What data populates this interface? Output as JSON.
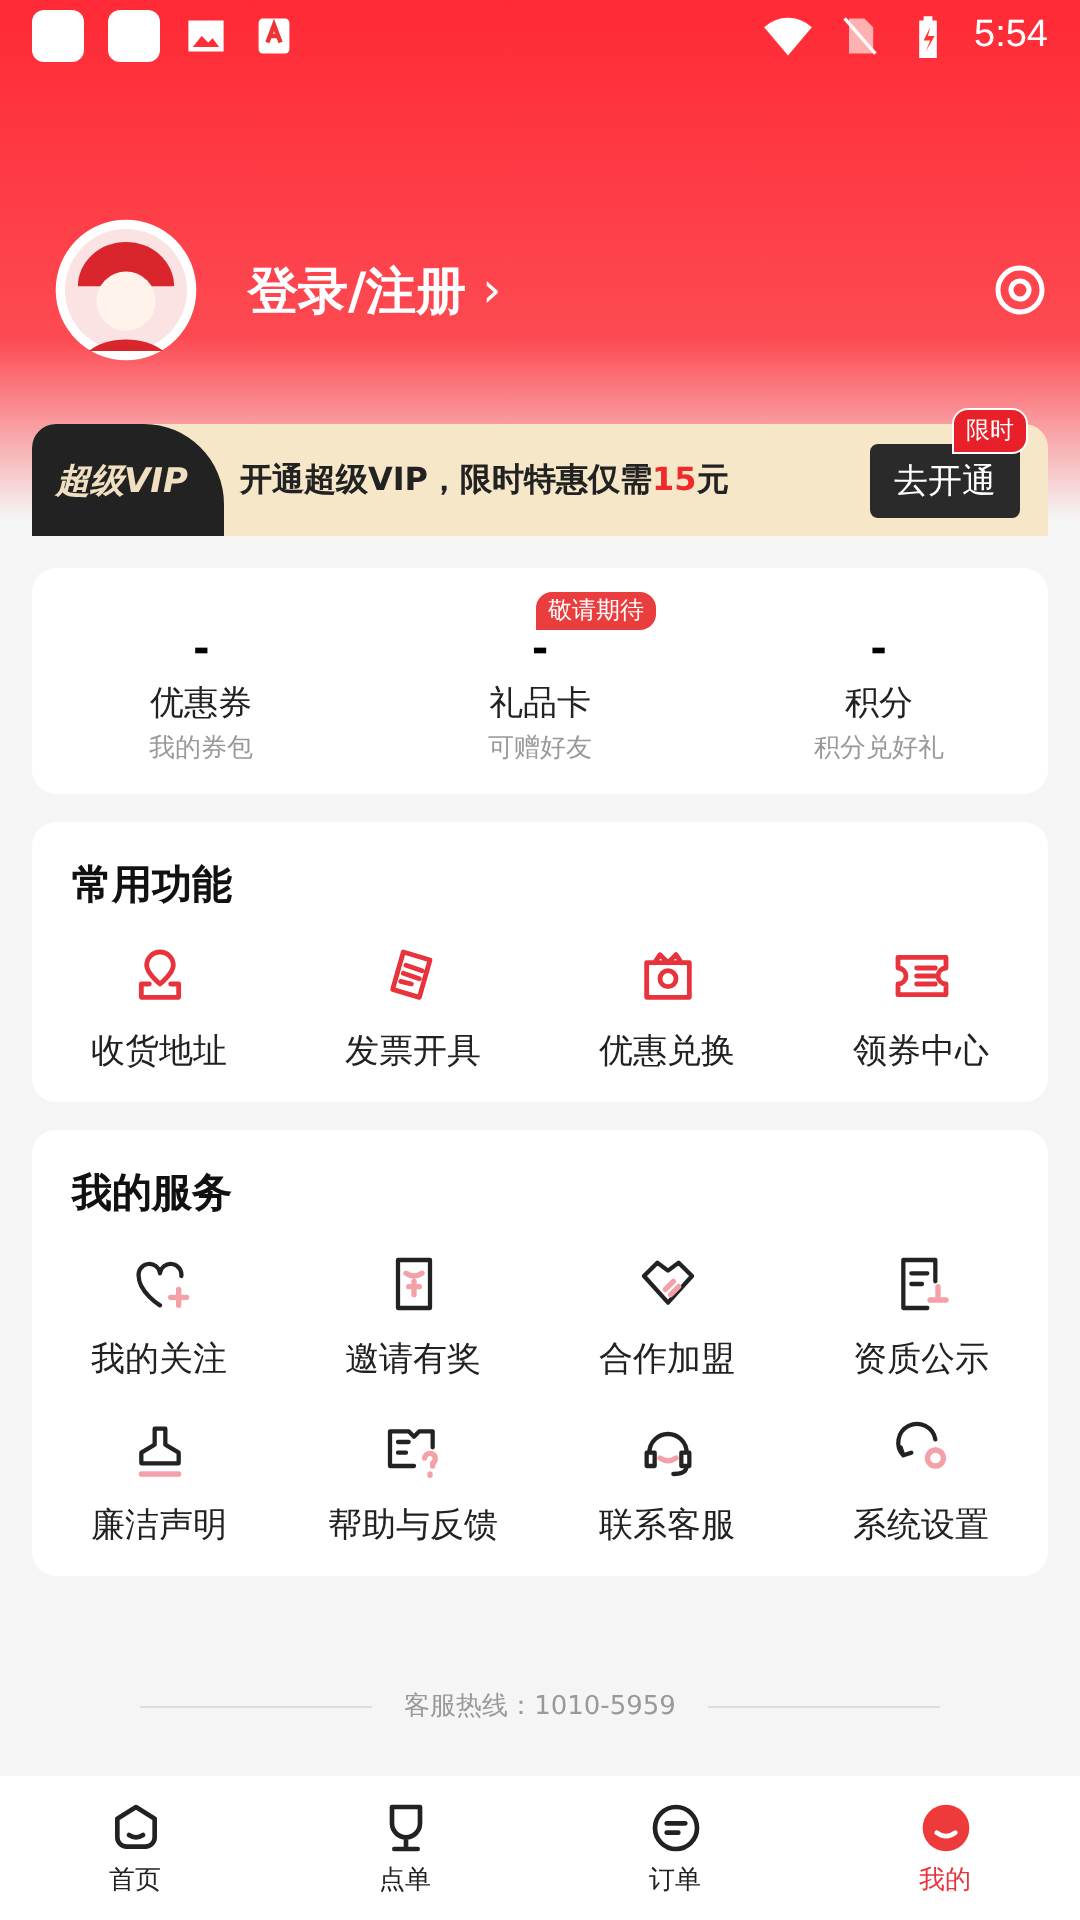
{
  "status_bar": {
    "time": "5:54"
  },
  "profile": {
    "login": "登录/注册",
    "chevron": "›"
  },
  "vip": {
    "logo": "超级VIP",
    "text": "开通超级VIP，限时特惠仅需",
    "price": "15",
    "unit": "元",
    "button": "去开通",
    "tag": "限时"
  },
  "stats": [
    {
      "value": "-",
      "label": "优惠券",
      "sub": "我的券包"
    },
    {
      "value": "-",
      "label": "礼品卡",
      "sub": "可赠好友",
      "badge": "敬请期待"
    },
    {
      "value": "-",
      "label": "积分",
      "sub": "积分兑好礼"
    }
  ],
  "common": {
    "title": "常用功能",
    "items": [
      "收货地址",
      "发票开具",
      "优惠兑换",
      "领券中心"
    ]
  },
  "services": {
    "title": "我的服务",
    "items": [
      "我的关注",
      "邀请有奖",
      "合作加盟",
      "资质公示",
      "廉洁声明",
      "帮助与反馈",
      "联系客服",
      "系统设置"
    ]
  },
  "hotline": "客服热线：1010-5959",
  "nav": [
    {
      "label": "首页",
      "selected": false
    },
    {
      "label": "点单",
      "selected": false
    },
    {
      "label": "订单",
      "selected": false
    },
    {
      "label": "我的",
      "selected": true
    }
  ]
}
